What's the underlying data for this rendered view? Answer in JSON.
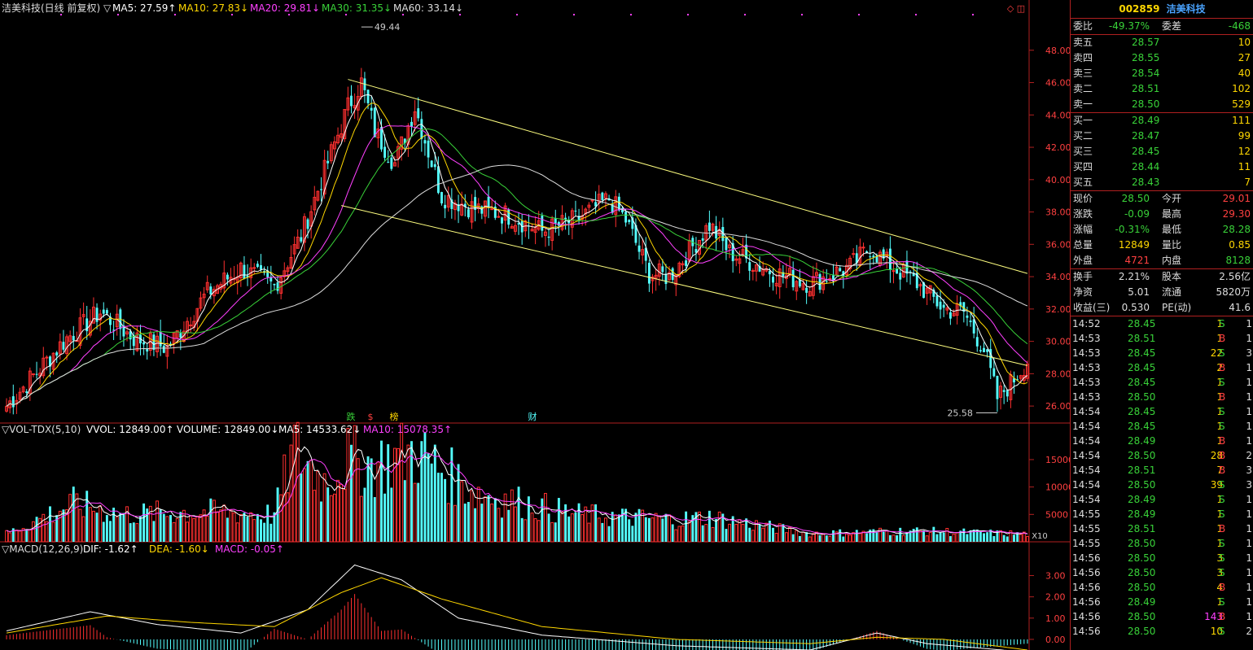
{
  "window": {
    "header_text": "洁美科技(日线 前复权) ▽",
    "corner_icons": "◇ ◫"
  },
  "chart_data": [
    {
      "type": "candlestick",
      "id": "price",
      "ylim": [
        25,
        50
      ],
      "yticks": [
        26,
        28,
        30,
        32,
        34,
        36,
        38,
        40,
        42,
        44,
        46,
        48
      ],
      "tick_labels": [
        "26.00",
        "28.00",
        "30.00",
        "32.00",
        "34.00",
        "36.00",
        "38.00",
        "40.00",
        "42.00",
        "44.00",
        "46.00",
        "48.00"
      ],
      "indicators": [
        {
          "name": "MA5",
          "value": "27.59",
          "dir": "↑",
          "color": "#ffffff"
        },
        {
          "name": "MA10",
          "value": "27.83",
          "dir": "↓",
          "color": "#ffd700"
        },
        {
          "name": "MA20",
          "value": "29.81",
          "dir": "↓",
          "color": "#ff40ff"
        },
        {
          "name": "MA30",
          "value": "31.35",
          "dir": "↓",
          "color": "#39d239"
        },
        {
          "name": "MA60",
          "value": "33.14",
          "dir": "↓",
          "color": "#dddddd"
        }
      ],
      "annotations": {
        "high": "49.44",
        "low": "25.58"
      },
      "event_markers": [
        "跌",
        "$",
        "榜",
        "财"
      ],
      "anchors": [
        [
          0,
          26.0
        ],
        [
          18,
          30.2
        ],
        [
          28,
          31.8
        ],
        [
          38,
          30.2
        ],
        [
          48,
          29.6
        ],
        [
          60,
          33.0
        ],
        [
          70,
          34.5
        ],
        [
          80,
          33.4
        ],
        [
          88,
          36.5
        ],
        [
          95,
          40.5
        ],
        [
          102,
          44.5
        ],
        [
          106,
          46.0
        ],
        [
          110,
          43.0
        ],
        [
          116,
          41.0
        ],
        [
          122,
          44.5
        ],
        [
          130,
          39.0
        ],
        [
          140,
          38.2
        ],
        [
          150,
          37.8
        ],
        [
          160,
          36.8
        ],
        [
          170,
          37.5
        ],
        [
          180,
          38.8
        ],
        [
          185,
          37.5
        ],
        [
          192,
          34.2
        ],
        [
          198,
          34.0
        ],
        [
          210,
          37.2
        ],
        [
          216,
          35.5
        ],
        [
          230,
          34.2
        ],
        [
          240,
          33.6
        ],
        [
          252,
          34.6
        ],
        [
          258,
          35.8
        ],
        [
          262,
          35.0
        ],
        [
          272,
          33.6
        ],
        [
          280,
          32.0
        ],
        [
          286,
          31.8
        ],
        [
          292,
          29.5
        ],
        [
          296,
          26.5
        ],
        [
          300,
          27.4
        ],
        [
          305,
          28.8
        ]
      ],
      "channel": [
        [
          [
            102,
            46.2
          ],
          [
            305,
            34.2
          ]
        ],
        [
          [
            100,
            38.4
          ],
          [
            305,
            28.5
          ]
        ]
      ],
      "ma_colors": {
        "ma5": "#ffffff",
        "ma10": "#ffd700",
        "ma20": "#ff40ff",
        "ma30": "#39d239",
        "ma60": "#dddddd"
      }
    },
    {
      "type": "bar",
      "id": "volume",
      "title": "VOL-TDX(5,10)",
      "ylim": [
        0,
        19000
      ],
      "yticks": [
        5000,
        10000,
        15000
      ],
      "tick_labels": [
        "5000",
        "10000",
        "15000"
      ],
      "scale_label": "X10",
      "indicators": [
        {
          "name": "VVOL",
          "value": "12849.00",
          "dir": "↑",
          "color": "#ffffff"
        },
        {
          "name": "VOLUME",
          "value": "12849.00",
          "dir": "↓",
          "color": "#ffffff"
        },
        {
          "name": "MA5",
          "value": "14533.62",
          "dir": "↓",
          "color": "#ffffff"
        },
        {
          "name": "MA10",
          "value": "15078.35",
          "dir": "↑",
          "color": "#ff40ff"
        }
      ],
      "anchors": [
        [
          0,
          1500
        ],
        [
          20,
          7000
        ],
        [
          35,
          5000
        ],
        [
          60,
          5500
        ],
        [
          80,
          5000
        ],
        [
          86,
          17000
        ],
        [
          95,
          11000
        ],
        [
          102,
          15000
        ],
        [
          110,
          14000
        ],
        [
          122,
          16500
        ],
        [
          140,
          9000
        ],
        [
          170,
          5000
        ],
        [
          200,
          4000
        ],
        [
          210,
          4500
        ],
        [
          240,
          1500
        ],
        [
          270,
          2000
        ],
        [
          305,
          1400
        ]
      ]
    },
    {
      "type": "bar",
      "id": "macd",
      "title": "MACD(12,26,9)",
      "ylim": [
        -0.5,
        3.9
      ],
      "yticks": [
        0,
        1,
        2,
        3
      ],
      "tick_labels": [
        "0.00",
        "1.00",
        "2.00",
        "3.00"
      ],
      "indicators": [
        {
          "name": "DIF",
          "value": "-1.62",
          "dir": "↑",
          "color": "#ffffff"
        },
        {
          "name": "DEA",
          "value": "-1.60",
          "dir": "↓",
          "color": "#ffd700"
        },
        {
          "name": "MACD",
          "value": "-0.05",
          "dir": "↑",
          "color": "#ff40ff"
        }
      ],
      "dif": [
        [
          0,
          0.4
        ],
        [
          25,
          1.3
        ],
        [
          45,
          0.7
        ],
        [
          70,
          0.3
        ],
        [
          90,
          1.4
        ],
        [
          104,
          3.5
        ],
        [
          118,
          2.8
        ],
        [
          135,
          1.0
        ],
        [
          160,
          0.2
        ],
        [
          200,
          -0.3
        ],
        [
          240,
          -0.5
        ],
        [
          260,
          0.3
        ],
        [
          275,
          -0.2
        ],
        [
          305,
          -0.6
        ]
      ],
      "dea": [
        [
          0,
          0.3
        ],
        [
          30,
          1.1
        ],
        [
          55,
          0.8
        ],
        [
          80,
          0.6
        ],
        [
          100,
          2.2
        ],
        [
          112,
          2.9
        ],
        [
          130,
          1.9
        ],
        [
          160,
          0.6
        ],
        [
          200,
          0.0
        ],
        [
          240,
          -0.2
        ],
        [
          260,
          0.1
        ],
        [
          280,
          0.0
        ],
        [
          305,
          -0.5
        ]
      ]
    }
  ],
  "quote": {
    "code": "002859",
    "name": "洁美科技",
    "webi": {
      "label": "委比",
      "value": "-49.37%",
      "label2": "委差",
      "value2": "-468"
    },
    "sells": [
      {
        "label": "卖五",
        "price": "28.57",
        "vol": "10"
      },
      {
        "label": "卖四",
        "price": "28.55",
        "vol": "27"
      },
      {
        "label": "卖三",
        "price": "28.54",
        "vol": "40"
      },
      {
        "label": "卖二",
        "price": "28.51",
        "vol": "102"
      },
      {
        "label": "卖一",
        "price": "28.50",
        "vol": "529"
      }
    ],
    "buys": [
      {
        "label": "买一",
        "price": "28.49",
        "vol": "111"
      },
      {
        "label": "买二",
        "price": "28.47",
        "vol": "99"
      },
      {
        "label": "买三",
        "price": "28.45",
        "vol": "12"
      },
      {
        "label": "买四",
        "price": "28.44",
        "vol": "11"
      },
      {
        "label": "买五",
        "price": "28.43",
        "vol": "7"
      }
    ],
    "stats": [
      {
        "l1": "现价",
        "v1": "28.50",
        "c1": "green",
        "l2": "今开",
        "v2": "29.01",
        "c2": "red"
      },
      {
        "l1": "涨跌",
        "v1": "-0.09",
        "c1": "green",
        "l2": "最高",
        "v2": "29.30",
        "c2": "red"
      },
      {
        "l1": "涨幅",
        "v1": "-0.31%",
        "c1": "green",
        "l2": "最低",
        "v2": "28.28",
        "c2": "green"
      },
      {
        "l1": "总量",
        "v1": "12849",
        "c1": "yellow",
        "l2": "量比",
        "v2": "0.85",
        "c2": "yellow"
      },
      {
        "l1": "外盘",
        "v1": "4721",
        "c1": "red",
        "l2": "内盘",
        "v2": "8128",
        "c2": "green"
      }
    ],
    "stats2": [
      {
        "l1": "换手",
        "v1": "2.21%",
        "l2": "股本",
        "v2": "2.56亿"
      },
      {
        "l1": "净资",
        "v1": "5.01",
        "l2": "流通",
        "v2": "5820万"
      },
      {
        "l1": "收益(三)",
        "v1": "0.530",
        "l2": "PE(动)",
        "v2": "41.6"
      }
    ],
    "ticks": [
      {
        "t": "14:52",
        "p": "28.45",
        "v": "1",
        "bs": "S",
        "n": "1"
      },
      {
        "t": "14:53",
        "p": "28.51",
        "v": "1",
        "bs": "B",
        "n": "1"
      },
      {
        "t": "14:53",
        "p": "28.45",
        "v": "22",
        "bs": "S",
        "n": "3"
      },
      {
        "t": "14:53",
        "p": "28.45",
        "v": "2",
        "bs": "B",
        "n": "1"
      },
      {
        "t": "14:53",
        "p": "28.45",
        "v": "1",
        "bs": "S",
        "n": "1"
      },
      {
        "t": "14:53",
        "p": "28.50",
        "v": "1",
        "bs": "B",
        "n": "1"
      },
      {
        "t": "14:54",
        "p": "28.45",
        "v": "1",
        "bs": "S",
        "n": "1"
      },
      {
        "t": "14:54",
        "p": "28.45",
        "v": "1",
        "bs": "S",
        "n": "1"
      },
      {
        "t": "14:54",
        "p": "28.49",
        "v": "1",
        "bs": "B",
        "n": "1"
      },
      {
        "t": "14:54",
        "p": "28.50",
        "v": "28",
        "bs": "B",
        "n": "2"
      },
      {
        "t": "14:54",
        "p": "28.51",
        "v": "7",
        "bs": "B",
        "n": "3"
      },
      {
        "t": "14:54",
        "p": "28.50",
        "v": "39",
        "bs": "S",
        "n": "3"
      },
      {
        "t": "14:54",
        "p": "28.49",
        "v": "1",
        "bs": "S",
        "n": "1"
      },
      {
        "t": "14:55",
        "p": "28.49",
        "v": "1",
        "bs": "S",
        "n": "1"
      },
      {
        "t": "14:55",
        "p": "28.51",
        "v": "1",
        "bs": "B",
        "n": "1"
      },
      {
        "t": "14:55",
        "p": "28.50",
        "v": "1",
        "bs": "S",
        "n": "1"
      },
      {
        "t": "14:56",
        "p": "28.50",
        "v": "3",
        "bs": "S",
        "n": "1"
      },
      {
        "t": "14:56",
        "p": "28.50",
        "v": "3",
        "bs": "S",
        "n": "1"
      },
      {
        "t": "14:56",
        "p": "28.50",
        "v": "4",
        "bs": "B",
        "n": "1"
      },
      {
        "t": "14:56",
        "p": "28.49",
        "v": "1",
        "bs": "S",
        "n": "1"
      },
      {
        "t": "14:56",
        "p": "28.50",
        "v": "143",
        "bs": "B",
        "n": "1"
      },
      {
        "t": "14:56",
        "p": "28.50",
        "v": "10",
        "bs": "S",
        "n": "2"
      }
    ]
  }
}
